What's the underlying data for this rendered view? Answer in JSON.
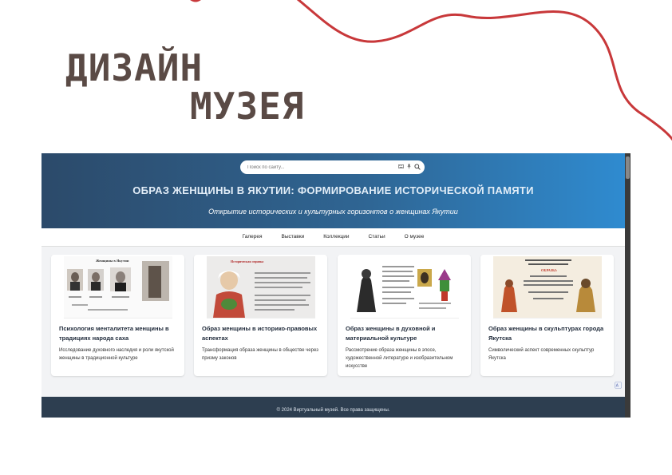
{
  "slide": {
    "title_line1": "ДИЗАЙН",
    "title_line2": "МУЗЕЯ",
    "accent_color": "#c8383a"
  },
  "site": {
    "search_placeholder": "Поиск по сайту...",
    "search_icons": [
      "keyboard-icon",
      "microphone-icon",
      "search-icon"
    ],
    "title": "ОБРАЗ ЖЕНЩИНЫ В ЯКУТИИ: ФОРМИРОВАНИЕ ИСТОРИЧЕСКОЙ ПАМЯТИ",
    "subtitle": "Открытие исторических и культурных горизонтов о женщинах Якутии",
    "header_gradient": [
      "#2c4a6a",
      "#2f8bd0"
    ],
    "nav": [
      "Галерея",
      "Выставки",
      "Коллекции",
      "Статьи",
      "О музее"
    ],
    "cards": [
      {
        "title": "Психология менталитета женщины в традициях народа саха",
        "desc": "Исследование духовного наследия и роли якутской женщины в традиционной культуре",
        "image_caption": "Женщины в Якутии"
      },
      {
        "title": "Образ женщины в историко-правовых аспектах",
        "desc": "Трансформация образа женщины в обществе через призму законов",
        "image_caption": "Историческая справка"
      },
      {
        "title": "Образ женщины в духовной и материальной культуре",
        "desc": "Рассмотрение образа женщины в эпосе, художественной литературе и изобразительном искусстве",
        "image_caption": ""
      },
      {
        "title": "Образ женщины в скульптурах города Якутска",
        "desc": "Символический аспект современных скульптур Якутска",
        "image_caption": "ОБРАЗЫ:"
      }
    ],
    "footer": "© 2024 Виртуальный музей. Все права защищены."
  }
}
